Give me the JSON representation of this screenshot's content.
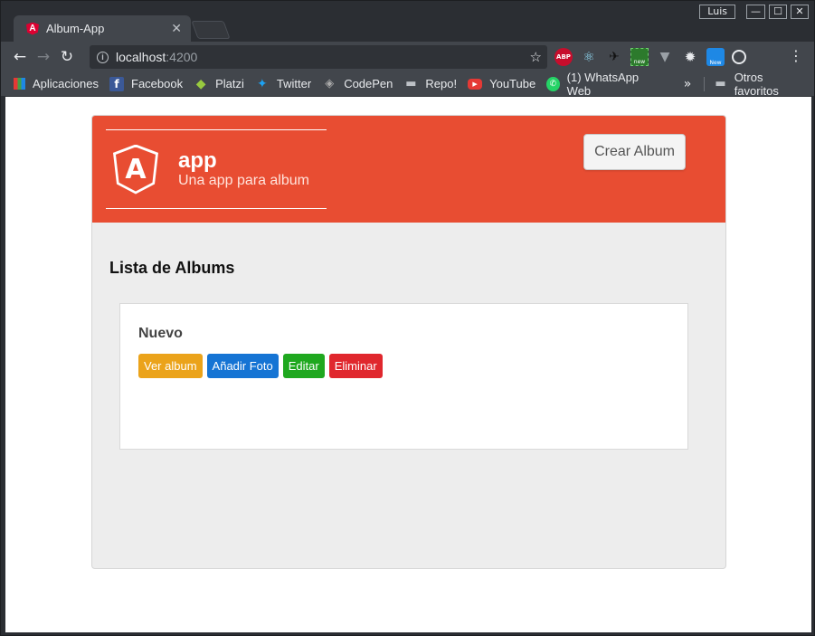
{
  "window": {
    "user": "Luis",
    "minimize": "—",
    "maximize": "☐",
    "close": "✕"
  },
  "tab": {
    "title": "Album-App",
    "close": "✕"
  },
  "toolbar": {
    "back": "←",
    "forward": "→",
    "reload": "↻",
    "url_host": "localhost",
    "url_port": ":4200",
    "bookmark_star": "☆",
    "menu": "⋮",
    "extensions": [
      {
        "name": "adblock-plus",
        "glyph": "ABP"
      },
      {
        "name": "react-devtools",
        "glyph": "⚛"
      },
      {
        "name": "bird-extension",
        "glyph": "✈"
      },
      {
        "name": "new-extension",
        "glyph": "new"
      },
      {
        "name": "vue-devtools",
        "glyph": "▼"
      },
      {
        "name": "settings-extension",
        "glyph": "✹"
      },
      {
        "name": "new-s-extension",
        "glyph": "New"
      },
      {
        "name": "target-extension",
        "glyph": ""
      }
    ]
  },
  "bookmarks": {
    "items": [
      {
        "label": "Aplicaciones",
        "icon": "apps-grid-icon"
      },
      {
        "label": "Facebook",
        "icon": "facebook-icon"
      },
      {
        "label": "Platzi",
        "icon": "platzi-icon"
      },
      {
        "label": "Twitter",
        "icon": "twitter-icon"
      },
      {
        "label": "CodePen",
        "icon": "codepen-icon"
      },
      {
        "label": "Repo!",
        "icon": "folder-icon"
      },
      {
        "label": "YouTube",
        "icon": "youtube-icon"
      },
      {
        "label": "(1) WhatsApp Web",
        "icon": "whatsapp-icon"
      }
    ],
    "more": "»",
    "other": "Otros favoritos"
  },
  "app": {
    "title": "app",
    "subtitle": "Una app para album",
    "create_button": "Crear Album",
    "list_title": "Lista de Albums",
    "albums": [
      {
        "name": "Nuevo",
        "actions": {
          "view": "Ver album",
          "add_photo": "Añadir Foto",
          "edit": "Editar",
          "delete": "Eliminar"
        }
      }
    ]
  },
  "colors": {
    "header": "#e84d32",
    "view": "#eba31a",
    "add_photo": "#1574d4",
    "edit": "#1fa81f",
    "delete": "#e0272d"
  }
}
